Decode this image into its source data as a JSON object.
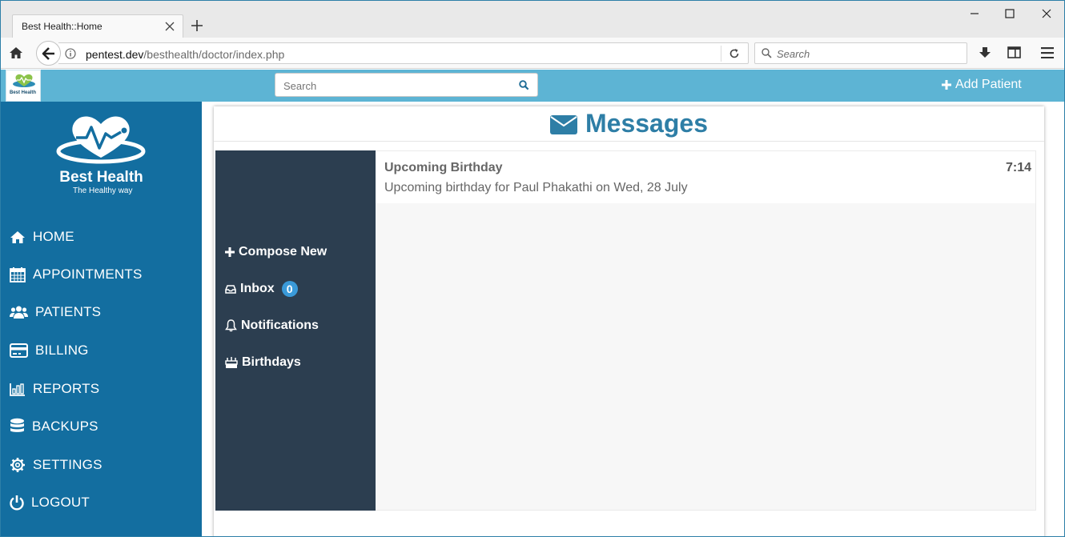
{
  "browser": {
    "tab_title": "Best Health::Home",
    "url_host": "pentest.dev",
    "url_path": "/besthealth/doctor/index.php",
    "search_placeholder": "Search"
  },
  "appbar": {
    "logo_text": "Best Health",
    "search_placeholder": "Search",
    "add_patient_label": "Add Patient"
  },
  "sidebar": {
    "brand_name": "Best Health",
    "brand_tagline": "The Healthy way",
    "items": [
      {
        "label": "HOME",
        "icon": "home-icon"
      },
      {
        "label": "APPOINTMENTS",
        "icon": "calendar-icon"
      },
      {
        "label": "PATIENTS",
        "icon": "users-icon"
      },
      {
        "label": "BILLING",
        "icon": "credit-card-icon"
      },
      {
        "label": "REPORTS",
        "icon": "bar-chart-icon"
      },
      {
        "label": "BACKUPS",
        "icon": "database-icon"
      },
      {
        "label": "SETTINGS",
        "icon": "gear-icon"
      },
      {
        "label": "LOGOUT",
        "icon": "power-icon"
      }
    ]
  },
  "messages": {
    "title": "Messages",
    "nav": {
      "compose": "Compose New",
      "inbox": "Inbox",
      "inbox_count": "0",
      "notifications": "Notifications",
      "birthdays": "Birthdays"
    },
    "items": [
      {
        "subject": "Upcoming Birthday",
        "body": "Upcoming birthday for Paul Phakathi on Wed, 28 July",
        "time": "7:14"
      }
    ]
  },
  "colors": {
    "sidebar": "#136ea0",
    "appbar": "#5db4d4",
    "message_nav": "#2c3e50",
    "title": "#2e7ea6",
    "badge": "#3a9ad9"
  }
}
